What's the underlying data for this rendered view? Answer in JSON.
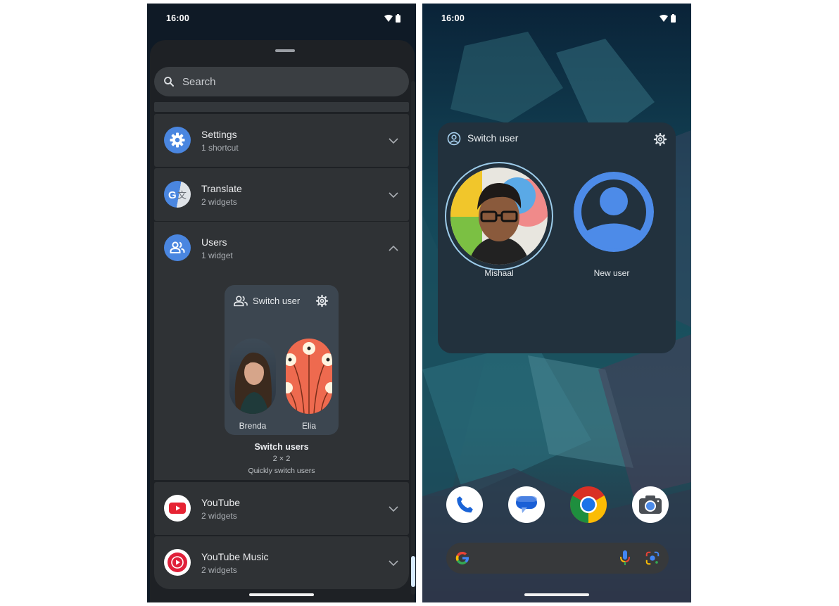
{
  "left_phone": {
    "status_bar": {
      "time": "16:00",
      "icons": [
        "wifi-icon",
        "battery-icon"
      ]
    },
    "widget_picker": {
      "search": {
        "placeholder": "Search"
      },
      "apps": [
        {
          "name": "Settings",
          "subtitle": "1 shortcut",
          "icon": "settings-gear-icon",
          "expanded": false
        },
        {
          "name": "Translate",
          "subtitle": "2 widgets",
          "icon": "google-translate-icon",
          "expanded": false
        },
        {
          "name": "Users",
          "subtitle": "1 widget",
          "icon": "users-icon",
          "expanded": true
        },
        {
          "name": "YouTube",
          "subtitle": "2 widgets",
          "icon": "youtube-icon",
          "expanded": false
        },
        {
          "name": "YouTube Music",
          "subtitle": "2 widgets",
          "icon": "youtube-music-icon",
          "expanded": false
        }
      ],
      "widget_preview": {
        "header_title": "Switch user",
        "users": [
          {
            "name": "Brenda",
            "avatar": "photo"
          },
          {
            "name": "Elia",
            "avatar": "flower-pattern"
          }
        ],
        "title": "Switch users",
        "size": "2 × 2",
        "description": "Quickly switch users"
      }
    }
  },
  "right_phone": {
    "status_bar": {
      "time": "16:00",
      "icons": [
        "wifi-icon",
        "battery-icon"
      ]
    },
    "switch_user_widget": {
      "title": "Switch user",
      "users": [
        {
          "name": "Mishaal",
          "avatar": "photo",
          "selected": true
        },
        {
          "name": "New user",
          "avatar": "default-person"
        }
      ]
    },
    "dock": [
      "Phone",
      "Messages",
      "Chrome",
      "Camera"
    ],
    "search_bar": {
      "icons": [
        "google-g-icon",
        "microphone-icon",
        "google-lens-icon"
      ]
    }
  },
  "colors": {
    "accent_blue": "#4285f4",
    "picker_bg": "#1e2125",
    "row_bg": "#2f3235",
    "widget_bg": "#22313d",
    "youtube_red": "#e62333"
  }
}
